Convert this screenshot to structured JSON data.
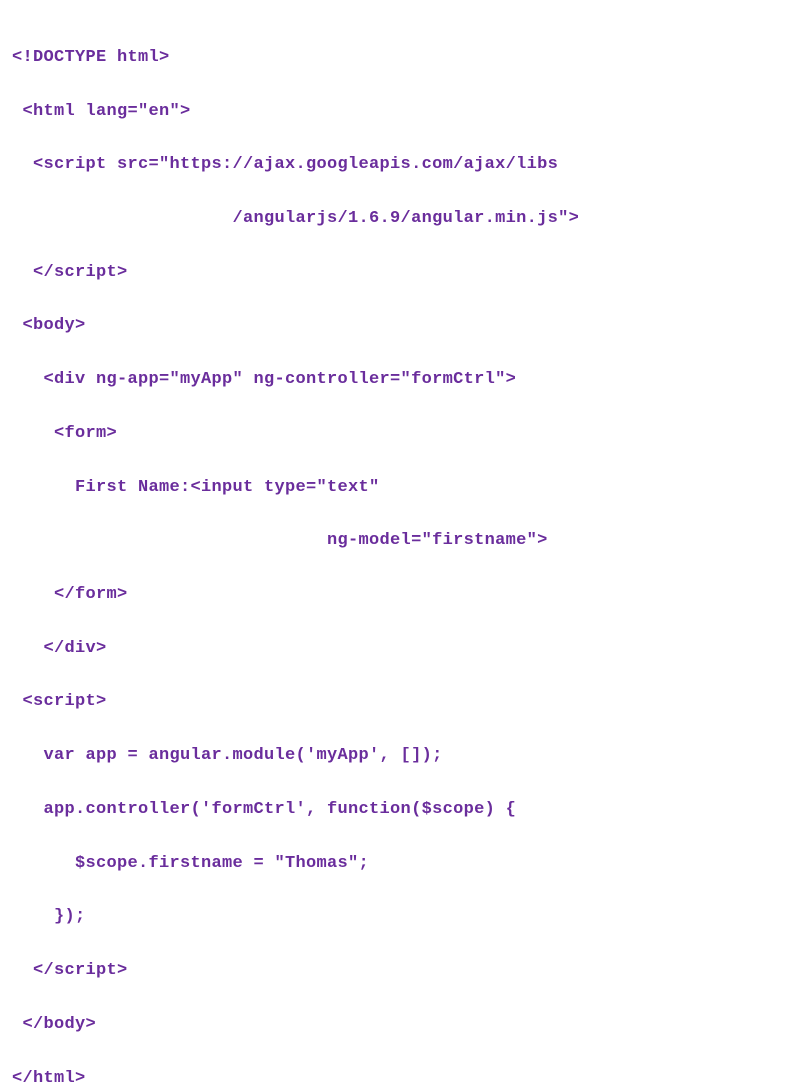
{
  "colors": {
    "text": "#6a2d9c",
    "background": "#ffffff"
  },
  "lines": [
    "<!DOCTYPE html>",
    " <html lang=\"en\">",
    "  <script src=\"https://ajax.googleapis.com/ajax/libs",
    "                     /angularjs/1.6.9/angular.min.js\">",
    "  </script>",
    " <body>",
    "   <div ng-app=\"myApp\" ng-controller=\"formCtrl\">",
    "    <form>",
    "      First Name:<input type=\"text\"",
    "                              ng-model=\"firstname\">",
    "    </form>",
    "   </div>",
    " <script>",
    "   var app = angular.module('myApp', []);",
    "   app.controller('formCtrl', function($scope) {",
    "      $scope.firstname = \"Thomas\";",
    "    });",
    "  </script>",
    " </body>",
    "</html>"
  ]
}
